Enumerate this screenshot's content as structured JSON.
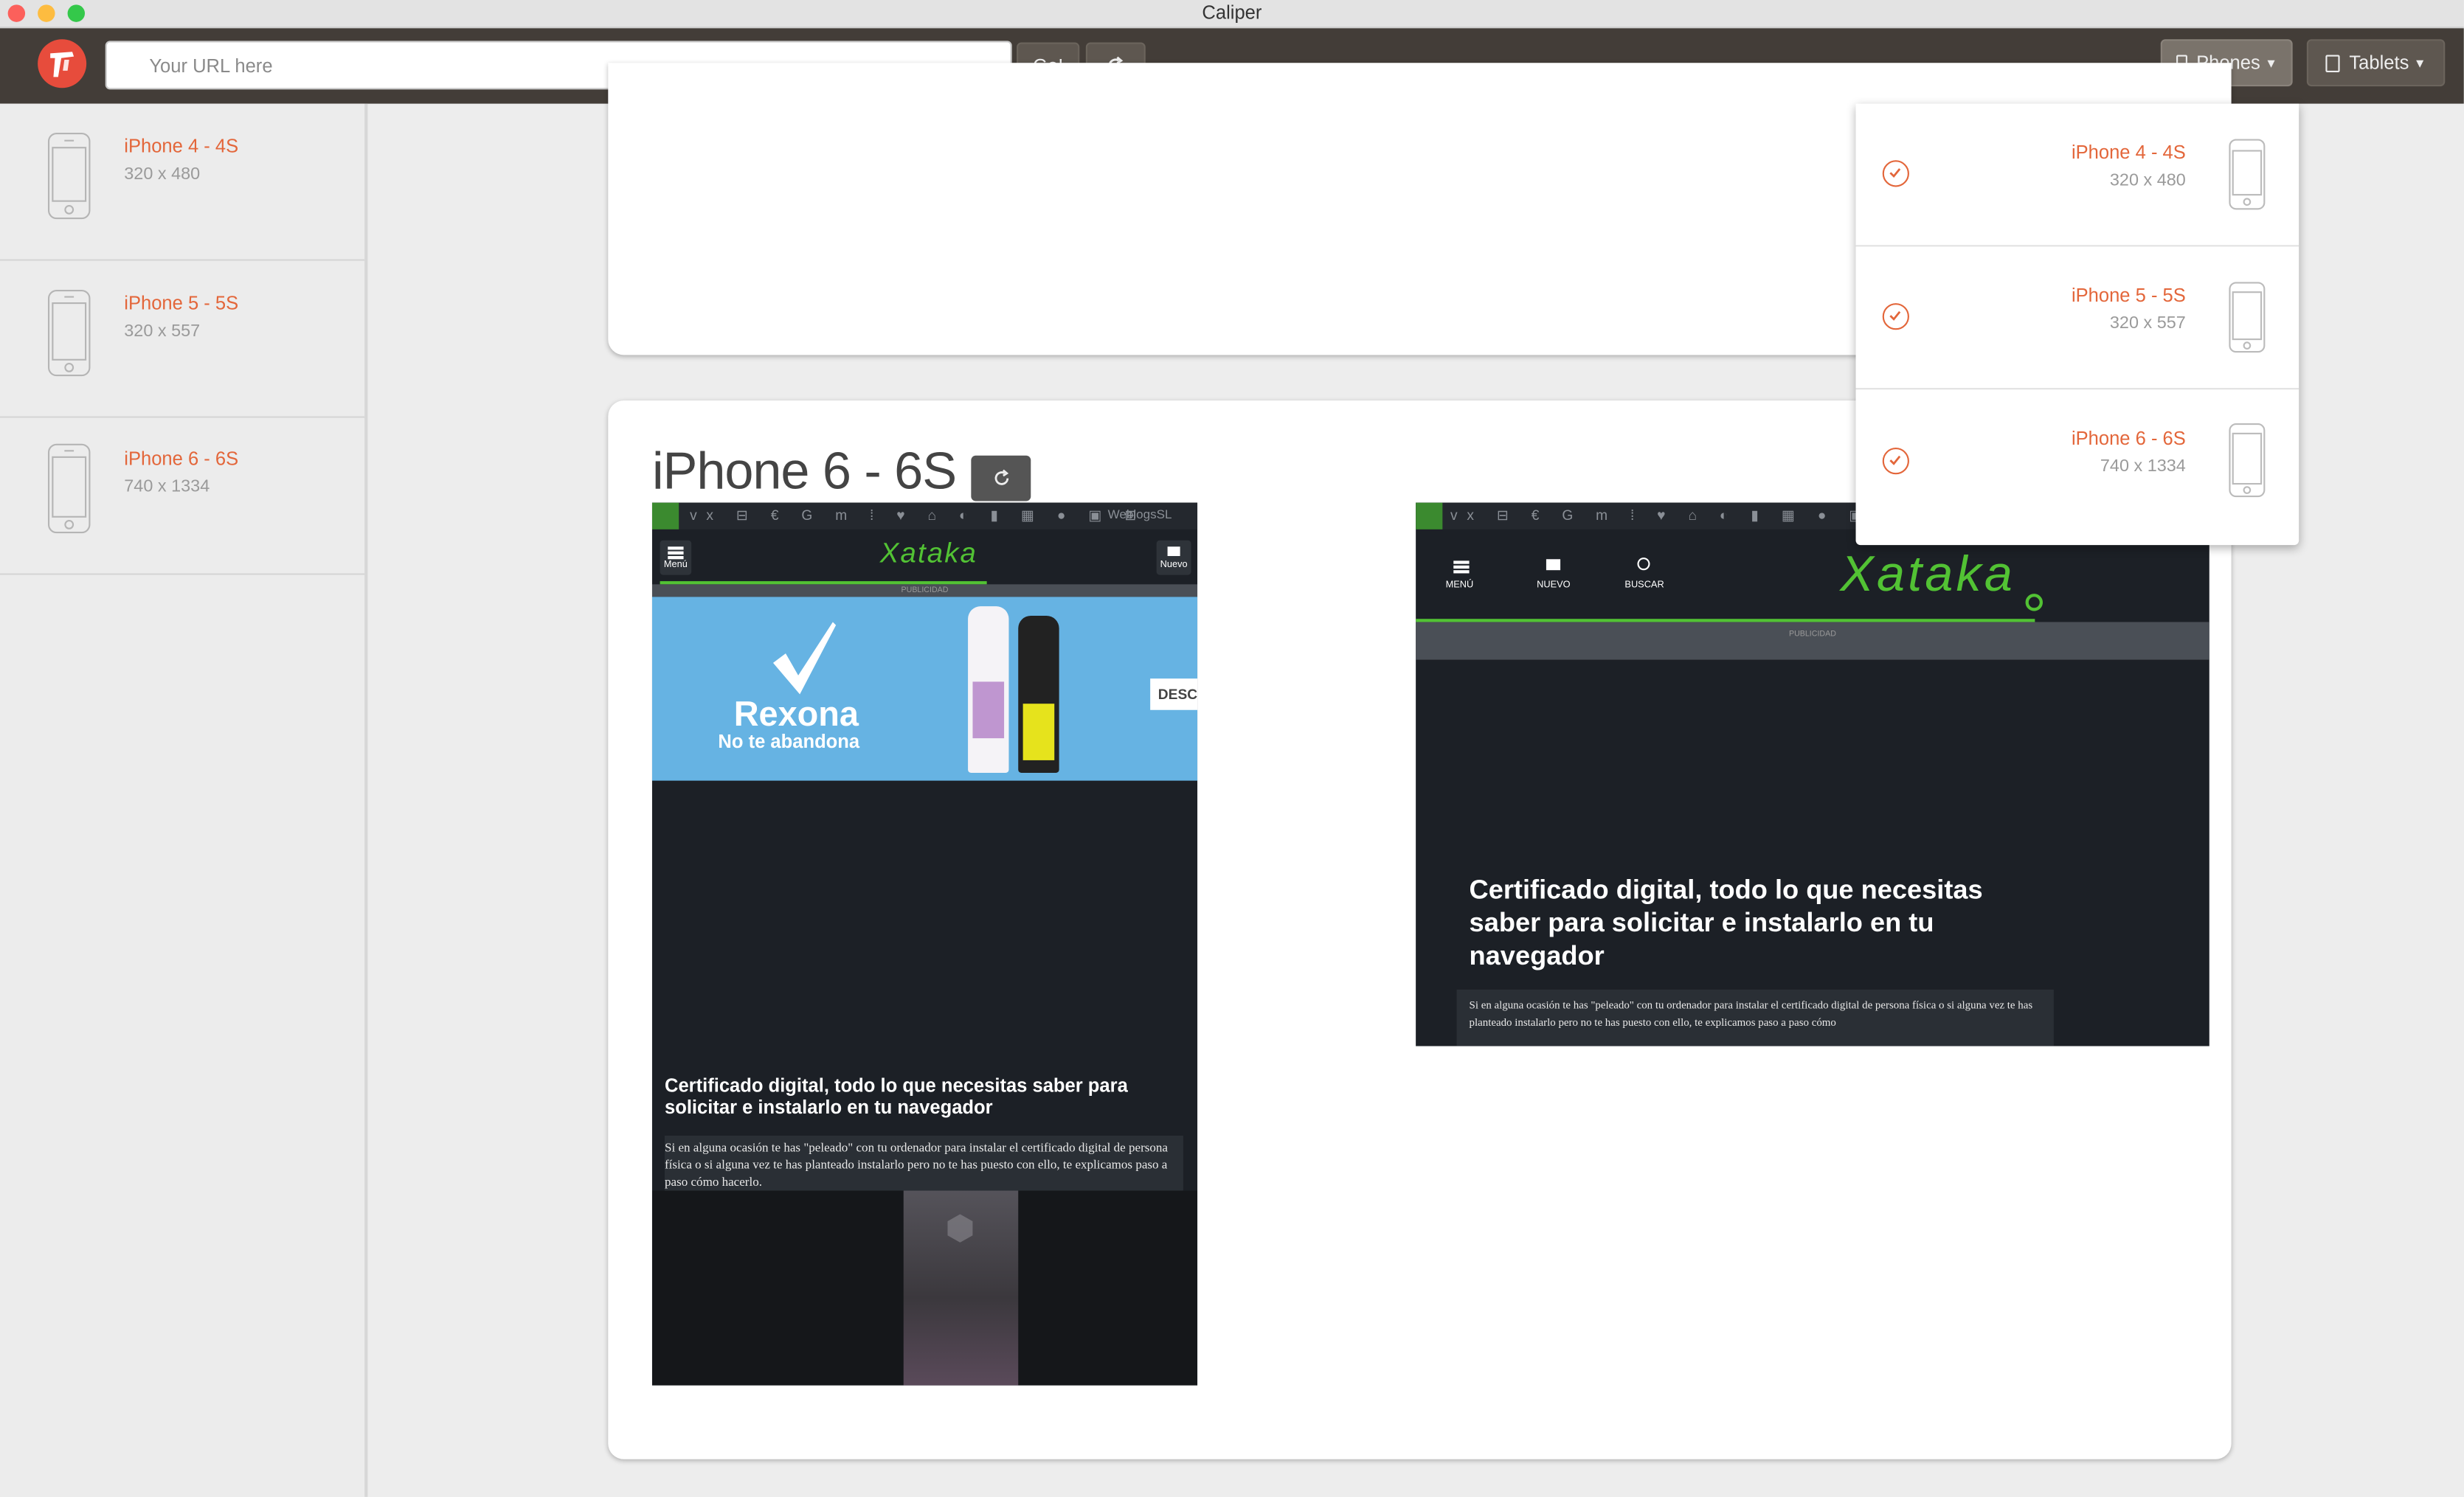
{
  "window": {
    "title": "Caliper"
  },
  "toolbar": {
    "url_placeholder": "Your URL here",
    "go_label": "Go!",
    "refresh_icon": "refresh-icon",
    "phones_label": "Phones",
    "tablets_label": "Tablets"
  },
  "sidebar": {
    "items": [
      {
        "name": "iPhone 4 - 4S",
        "size": "320 x 480"
      },
      {
        "name": "iPhone 5 - 5S",
        "size": "320 x 557"
      },
      {
        "name": "iPhone 6 - 6S",
        "size": "740 x 1334"
      }
    ]
  },
  "dropdown": {
    "items": [
      {
        "name": "iPhone 4 - 4S",
        "size": "320 x 480",
        "checked": true
      },
      {
        "name": "iPhone 5 - 5S",
        "size": "320 x 557",
        "checked": true
      },
      {
        "name": "iPhone 6 - 6S",
        "size": "740 x 1334",
        "checked": true
      }
    ]
  },
  "device_panel": {
    "title": "iPhone 6 - 6S"
  },
  "site": {
    "logo": "Xataka",
    "network": "WeblogsSL",
    "menu": "Menú",
    "nuevo": "Nuevo",
    "menu_upper": "MENÚ",
    "nuevo_upper": "NUEVO",
    "buscar_upper": "BUSCAR",
    "ad_label": "PUBLICIDAD",
    "ad": {
      "brand": "Rexona",
      "tagline": "No te abandona",
      "cta": "DESC"
    },
    "headline": "Certificado digital, todo lo que necesitas saber para solicitar e instalarlo en tu navegador",
    "excerpt_portrait": "Si en alguna ocasión te has \"peleado\" con tu ordenador para instalar el certificado digital de persona física o si alguna vez te has planteado instalarlo pero no te has puesto con ello, te explicamos paso a paso cómo hacerlo.",
    "excerpt_landscape": "Si en alguna ocasión te has \"peleado\" con tu ordenador para instalar el certificado digital de persona física o si alguna vez te has planteado instalarlo pero no te has puesto con ello, te explicamos paso a paso cómo"
  },
  "colors": {
    "accent": "#e3663a",
    "toolbar": "#433d38",
    "xataka_green": "#52c234"
  }
}
